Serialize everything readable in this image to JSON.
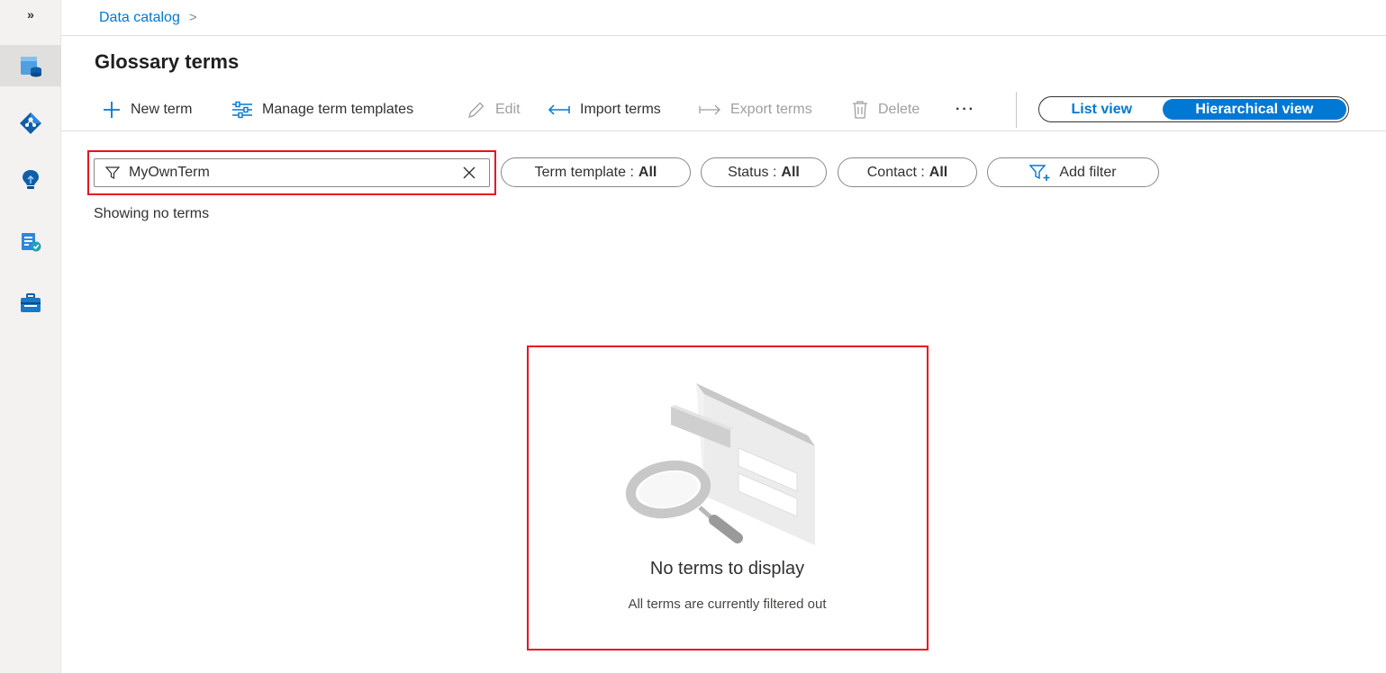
{
  "rail": {
    "expand_glyph": "»",
    "items": [
      {
        "icon": "data-catalog-icon",
        "active": true
      },
      {
        "icon": "data-map-icon",
        "active": false
      },
      {
        "icon": "insights-icon",
        "active": false
      },
      {
        "icon": "policy-icon",
        "active": false
      },
      {
        "icon": "management-icon",
        "active": false
      }
    ]
  },
  "breadcrumb": {
    "item": "Data catalog",
    "separator": ">"
  },
  "page": {
    "title": "Glossary terms"
  },
  "toolbar": {
    "new_term": "New term",
    "manage_templates": "Manage term templates",
    "edit": "Edit",
    "import_terms": "Import terms",
    "export_terms": "Export terms",
    "delete": "Delete",
    "more": "···",
    "list_view": "List view",
    "hierarchical_view": "Hierarchical view",
    "selected_view": "Hierarchical view"
  },
  "filters": {
    "search_value": "MyOwnTerm",
    "term_template_label": "Term template :",
    "term_template_value": "All",
    "status_label": "Status :",
    "status_value": "All",
    "contact_label": "Contact :",
    "contact_value": "All",
    "add_filter": "Add filter"
  },
  "results": {
    "count_text": "Showing no terms"
  },
  "empty_state": {
    "title": "No terms to display",
    "subtitle": "All terms are currently filtered out"
  },
  "colors": {
    "accent": "#0078d4",
    "highlight": "#e81123",
    "rail_bg": "#f3f2f1"
  }
}
